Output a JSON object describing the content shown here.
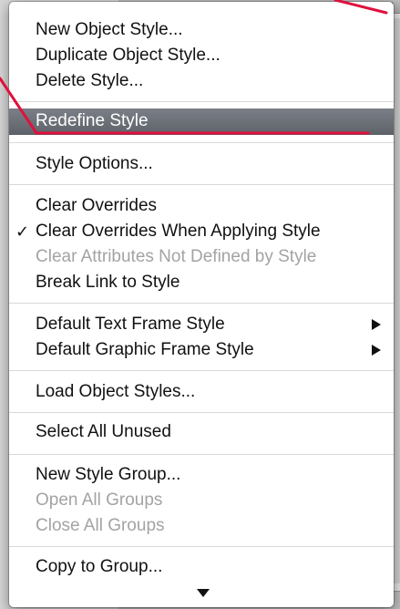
{
  "menu": {
    "items": [
      {
        "label": "New Object Style...",
        "disabled": false
      },
      {
        "label": "Duplicate Object Style...",
        "disabled": false
      },
      {
        "label": "Delete Style...",
        "disabled": false
      },
      {
        "label": "Redefine Style",
        "disabled": false,
        "highlighted": true
      },
      {
        "label": "Style Options...",
        "disabled": false
      },
      {
        "label": "Clear Overrides",
        "disabled": false
      },
      {
        "label": "Clear Overrides When Applying Style",
        "disabled": false,
        "checked": true,
        "check_glyph": "✓"
      },
      {
        "label": "Clear Attributes Not Defined by Style",
        "disabled": true
      },
      {
        "label": "Break Link to Style",
        "disabled": false
      },
      {
        "label": "Default Text Frame Style",
        "disabled": false,
        "submenu": true
      },
      {
        "label": "Default Graphic Frame Style",
        "disabled": false,
        "submenu": true
      },
      {
        "label": "Load Object Styles...",
        "disabled": false
      },
      {
        "label": "Select All Unused",
        "disabled": false
      },
      {
        "label": "New Style Group...",
        "disabled": false
      },
      {
        "label": "Open All Groups",
        "disabled": true
      },
      {
        "label": "Close All Groups",
        "disabled": true
      },
      {
        "label": "Copy to Group...",
        "disabled": false
      }
    ]
  },
  "panel": {
    "close_glyph": "×",
    "collapse_glyph": "◂◂"
  },
  "colors": {
    "highlight": "#5d6168",
    "annotation": "#e0103c",
    "disabled_text": "#a3a3a3"
  }
}
